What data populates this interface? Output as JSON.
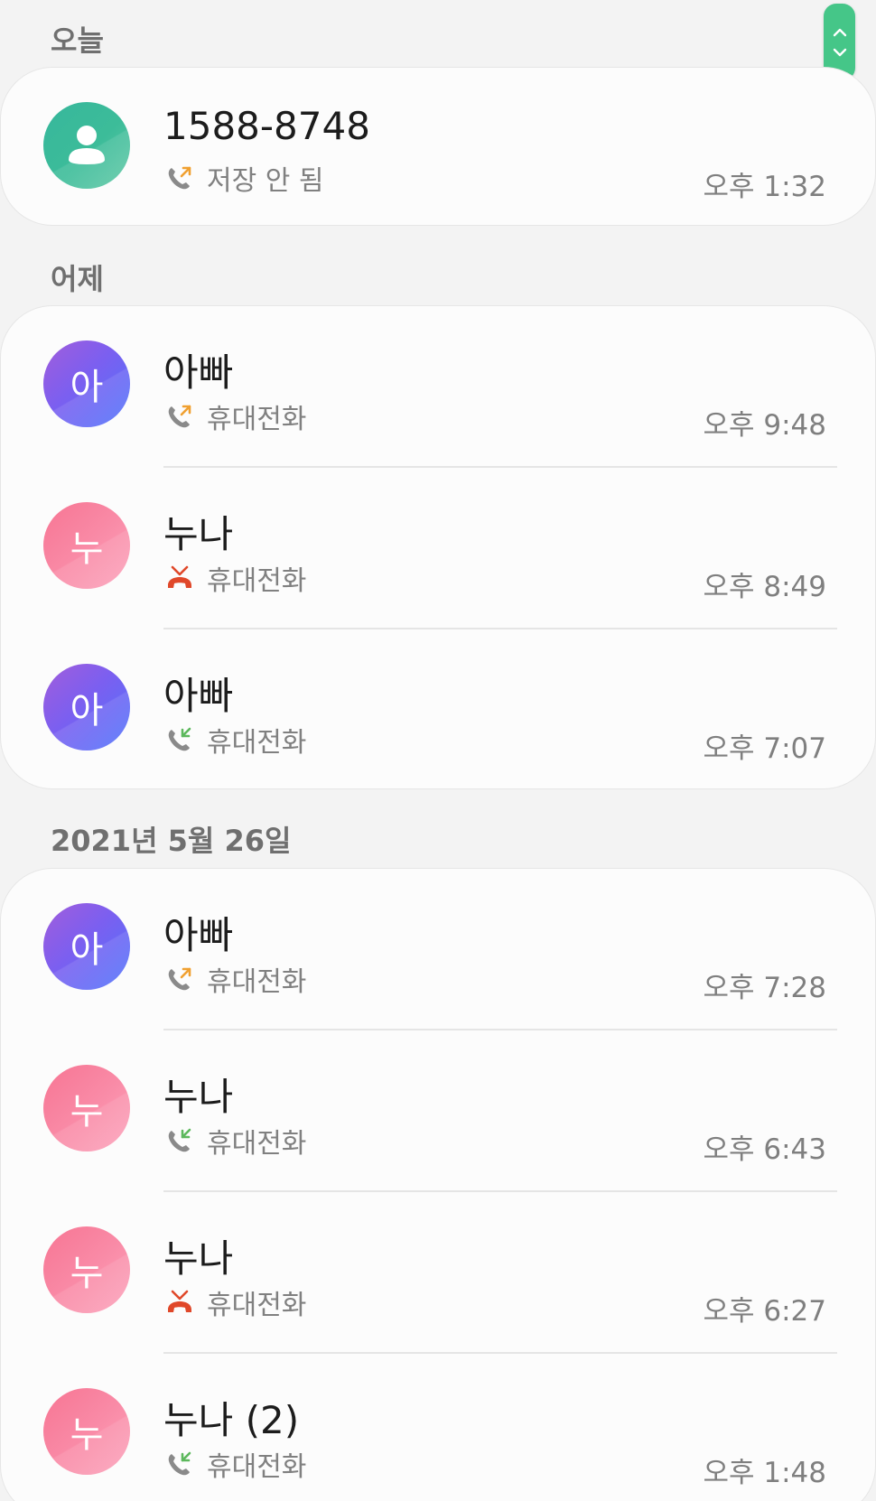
{
  "scroll_handle": {
    "icons": [
      "chevron-up-icon",
      "chevron-down-icon"
    ],
    "color": "#45c688"
  },
  "colors": {
    "outgoing_arrow": "#f0a030",
    "incoming_arrow": "#5cb85c",
    "missed": "#e0482a",
    "phone_glyph": "#8a8a8a"
  },
  "groups": [
    {
      "header": "오늘",
      "calls": [
        {
          "name": "1588-8748",
          "avatar": {
            "type": "person-icon",
            "color": "teal"
          },
          "call_type": "outgoing",
          "label": "저장 안 됨",
          "time": "오후 1:32"
        }
      ]
    },
    {
      "header": "어제",
      "calls": [
        {
          "name": "아빠",
          "avatar": {
            "letter": "아",
            "color": "purple"
          },
          "call_type": "outgoing",
          "label": "휴대전화",
          "time": "오후 9:48"
        },
        {
          "name": "누나",
          "avatar": {
            "letter": "누",
            "color": "pink"
          },
          "call_type": "missed",
          "label": "휴대전화",
          "time": "오후 8:49"
        },
        {
          "name": "아빠",
          "avatar": {
            "letter": "아",
            "color": "purple"
          },
          "call_type": "incoming",
          "label": "휴대전화",
          "time": "오후 7:07"
        }
      ]
    },
    {
      "header": "2021년 5월 26일",
      "calls": [
        {
          "name": "아빠",
          "avatar": {
            "letter": "아",
            "color": "purple"
          },
          "call_type": "outgoing",
          "label": "휴대전화",
          "time": "오후 7:28"
        },
        {
          "name": "누나",
          "avatar": {
            "letter": "누",
            "color": "pink"
          },
          "call_type": "incoming",
          "label": "휴대전화",
          "time": "오후 6:43"
        },
        {
          "name": "누나",
          "avatar": {
            "letter": "누",
            "color": "pink"
          },
          "call_type": "missed",
          "label": "휴대전화",
          "time": "오후 6:27"
        },
        {
          "name": "누나 (2)",
          "avatar": {
            "letter": "누",
            "color": "pink"
          },
          "call_type": "incoming",
          "label": "휴대전화",
          "time": "오후 1:48"
        }
      ]
    }
  ]
}
